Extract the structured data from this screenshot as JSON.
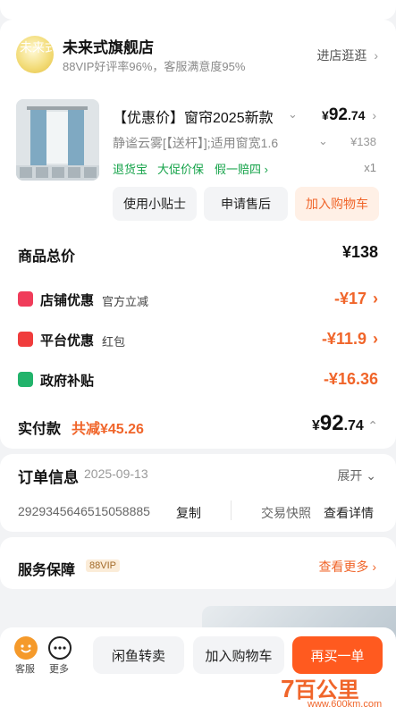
{
  "store": {
    "logo_text": "未来式",
    "name": "未来式旗舰店",
    "rating": "88VIP好评率96%，客服满意度95%",
    "visit_label": "进店逛逛"
  },
  "product": {
    "title": "【优惠价】窗帘2025新款",
    "price_symbol": "¥",
    "price_int": "92",
    "price_dec": ".74",
    "spec": "静谧云雾[【送杆】];适用窗宽1.6",
    "original_price": "¥138",
    "tags": [
      "退货宝",
      "大促价保",
      "假一赔四"
    ],
    "quantity": "x1",
    "actions": [
      "使用小贴士",
      "申请售后",
      "加入购物车"
    ]
  },
  "summary": {
    "total_label": "商品总价",
    "total_value": "¥138",
    "discounts": [
      {
        "name": "店铺优惠",
        "sub": "官方立减",
        "value": "-¥17",
        "icon_color": "#f03c5a"
      },
      {
        "name": "平台优惠",
        "sub": "红包",
        "value": "-¥11.9",
        "icon_color": "#f03c3c"
      },
      {
        "name": "政府补贴",
        "sub": "",
        "value": "-¥16.36",
        "icon_color": "#22b36b"
      }
    ],
    "paid_label": "实付款",
    "saved_label": "共减¥45.26",
    "paid_symbol": "¥",
    "paid_int": "92",
    "paid_dec": ".74"
  },
  "order": {
    "title": "订单信息",
    "date": "2025-09-13",
    "expand_label": "展开",
    "number": "2929345646515058885",
    "copy_label": "复制",
    "snapshot_label": "交易快照",
    "details_label": "查看详情"
  },
  "service": {
    "title": "服务保障",
    "badge": "88VIP",
    "more_label": "查看更多"
  },
  "bottom": {
    "service_label": "客服",
    "more_label": "更多",
    "xianyu_label": "闲鱼转卖",
    "cart_label": "加入购物车",
    "rebuy_label": "再买一单"
  },
  "watermark": {
    "brand": "百公里",
    "url": "www.600km.com"
  },
  "colors": {
    "accent": "#ff5a1f",
    "discount": "#f0652a",
    "green": "#16a34a"
  }
}
